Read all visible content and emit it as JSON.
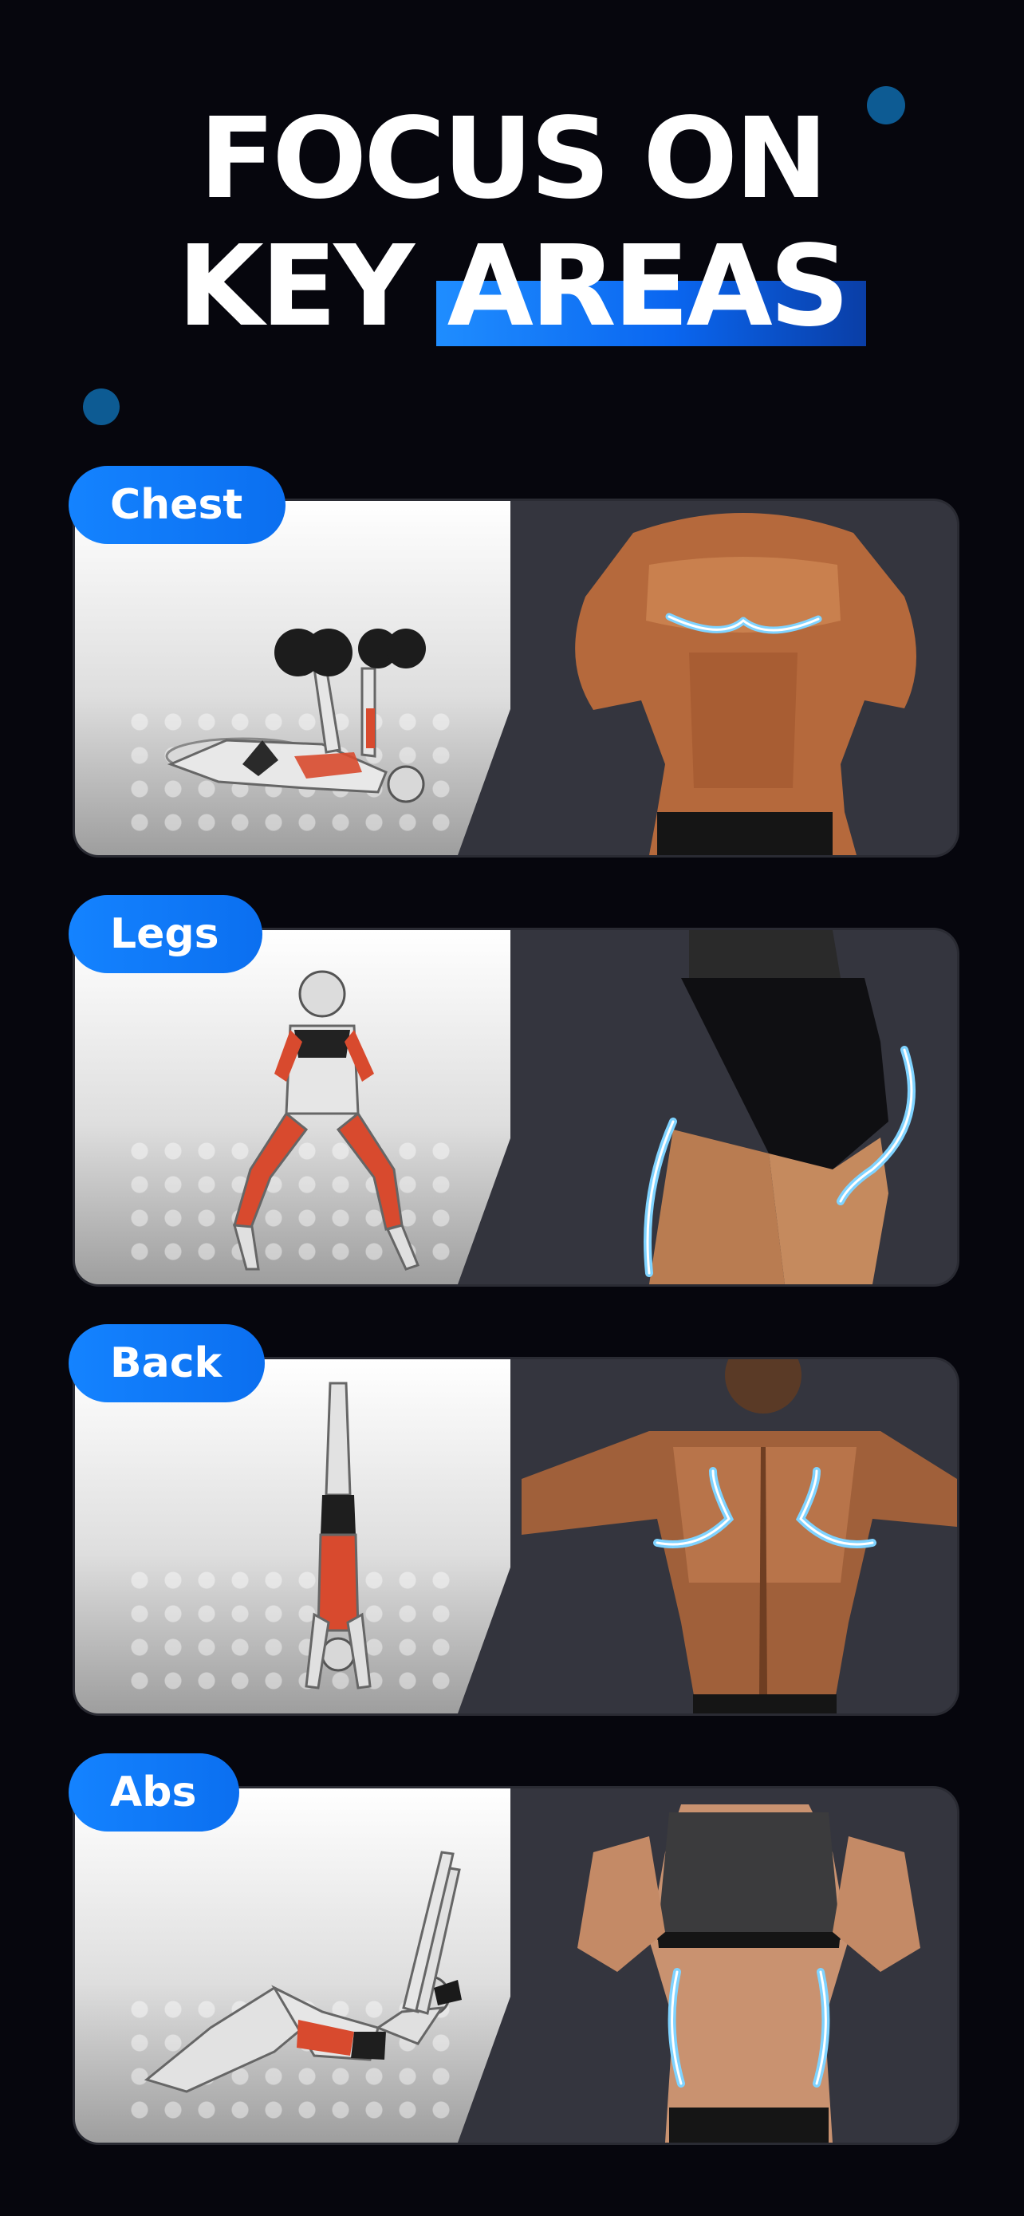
{
  "headline": {
    "line1": "FOCUS ON",
    "line2_prefix": "KEY ",
    "line2_highlight": "AREAS"
  },
  "cards": [
    {
      "label": "Chest"
    },
    {
      "label": "Legs"
    },
    {
      "label": "Back"
    },
    {
      "label": "Abs"
    }
  ],
  "colors": {
    "background": "#06060d",
    "accent": "#0b6ff0",
    "dot": "#0d5b93",
    "card_dark": "#34353e",
    "glow": "#7fd3ff",
    "muscle": "#d84a2e"
  }
}
